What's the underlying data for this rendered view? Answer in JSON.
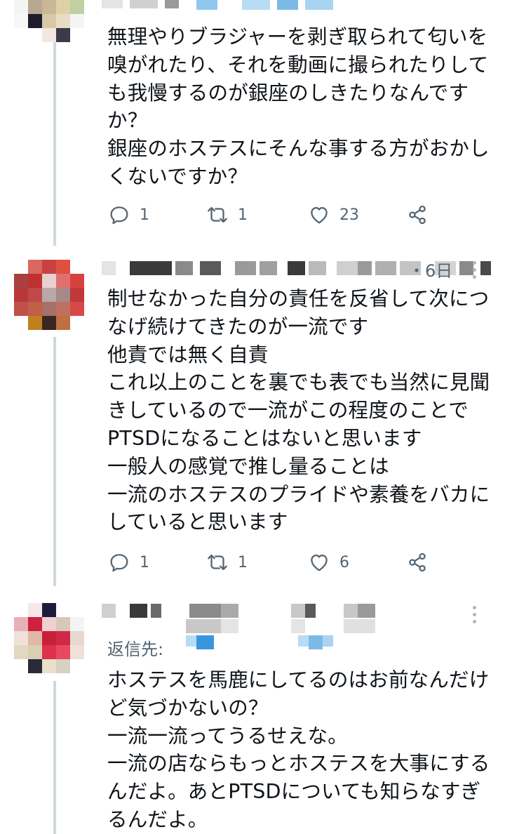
{
  "tweets": [
    {
      "body": "無理やりブラジャーを剥ぎ取られて匂いを嗅がれたり、それを動画に撮られたりしても我慢するのが銀座のしきたりなんですか？\n銀座のホステスにそんな事する方がおかしくないですか？",
      "replies": "1",
      "retweets": "1",
      "likes": "23"
    },
    {
      "time": "・6日",
      "body": "制せなかった自分の責任を反省して次につなげ続けてきたのが一流です\n他責では無く自責\nこれ以上のことを裏でも表でも当然に見聞きしているので一流がこの程度のことでPTSDになることはないと思います\n一般人の感覚で推し量ることは\n一流のホステスのプライドや素養をバカにしていると思います",
      "replies": "1",
      "retweets": "1",
      "likes": "6"
    },
    {
      "reply_label": "返信先:",
      "body": "ホステスを馬鹿にしてるのはお前なんだけど気づかないの？\n一流一流ってうるせえな。\n一流の店ならもっとホステスを大事にするんだよ。あとPTSDについても知らなすぎるんだよ。"
    }
  ],
  "icons": [
    "reply-icon",
    "retweet-icon",
    "like-icon",
    "share-icon",
    "more-icon"
  ],
  "colors": {
    "text": "#0f1419",
    "muted": "#536471",
    "line": "#cfd9de",
    "link": "#1d9bf0"
  }
}
